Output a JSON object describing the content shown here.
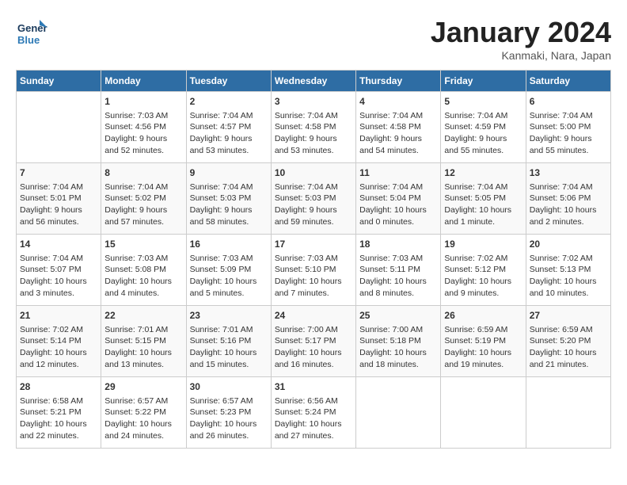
{
  "header": {
    "logo_general": "General",
    "logo_blue": "Blue",
    "month": "January 2024",
    "location": "Kanmaki, Nara, Japan"
  },
  "days_of_week": [
    "Sunday",
    "Monday",
    "Tuesday",
    "Wednesday",
    "Thursday",
    "Friday",
    "Saturday"
  ],
  "weeks": [
    [
      {
        "day": "",
        "content": ""
      },
      {
        "day": "1",
        "content": "Sunrise: 7:03 AM\nSunset: 4:56 PM\nDaylight: 9 hours\nand 52 minutes."
      },
      {
        "day": "2",
        "content": "Sunrise: 7:04 AM\nSunset: 4:57 PM\nDaylight: 9 hours\nand 53 minutes."
      },
      {
        "day": "3",
        "content": "Sunrise: 7:04 AM\nSunset: 4:58 PM\nDaylight: 9 hours\nand 53 minutes."
      },
      {
        "day": "4",
        "content": "Sunrise: 7:04 AM\nSunset: 4:58 PM\nDaylight: 9 hours\nand 54 minutes."
      },
      {
        "day": "5",
        "content": "Sunrise: 7:04 AM\nSunset: 4:59 PM\nDaylight: 9 hours\nand 55 minutes."
      },
      {
        "day": "6",
        "content": "Sunrise: 7:04 AM\nSunset: 5:00 PM\nDaylight: 9 hours\nand 55 minutes."
      }
    ],
    [
      {
        "day": "7",
        "content": "Sunrise: 7:04 AM\nSunset: 5:01 PM\nDaylight: 9 hours\nand 56 minutes."
      },
      {
        "day": "8",
        "content": "Sunrise: 7:04 AM\nSunset: 5:02 PM\nDaylight: 9 hours\nand 57 minutes."
      },
      {
        "day": "9",
        "content": "Sunrise: 7:04 AM\nSunset: 5:03 PM\nDaylight: 9 hours\nand 58 minutes."
      },
      {
        "day": "10",
        "content": "Sunrise: 7:04 AM\nSunset: 5:03 PM\nDaylight: 9 hours\nand 59 minutes."
      },
      {
        "day": "11",
        "content": "Sunrise: 7:04 AM\nSunset: 5:04 PM\nDaylight: 10 hours\nand 0 minutes."
      },
      {
        "day": "12",
        "content": "Sunrise: 7:04 AM\nSunset: 5:05 PM\nDaylight: 10 hours\nand 1 minute."
      },
      {
        "day": "13",
        "content": "Sunrise: 7:04 AM\nSunset: 5:06 PM\nDaylight: 10 hours\nand 2 minutes."
      }
    ],
    [
      {
        "day": "14",
        "content": "Sunrise: 7:04 AM\nSunset: 5:07 PM\nDaylight: 10 hours\nand 3 minutes."
      },
      {
        "day": "15",
        "content": "Sunrise: 7:03 AM\nSunset: 5:08 PM\nDaylight: 10 hours\nand 4 minutes."
      },
      {
        "day": "16",
        "content": "Sunrise: 7:03 AM\nSunset: 5:09 PM\nDaylight: 10 hours\nand 5 minutes."
      },
      {
        "day": "17",
        "content": "Sunrise: 7:03 AM\nSunset: 5:10 PM\nDaylight: 10 hours\nand 7 minutes."
      },
      {
        "day": "18",
        "content": "Sunrise: 7:03 AM\nSunset: 5:11 PM\nDaylight: 10 hours\nand 8 minutes."
      },
      {
        "day": "19",
        "content": "Sunrise: 7:02 AM\nSunset: 5:12 PM\nDaylight: 10 hours\nand 9 minutes."
      },
      {
        "day": "20",
        "content": "Sunrise: 7:02 AM\nSunset: 5:13 PM\nDaylight: 10 hours\nand 10 minutes."
      }
    ],
    [
      {
        "day": "21",
        "content": "Sunrise: 7:02 AM\nSunset: 5:14 PM\nDaylight: 10 hours\nand 12 minutes."
      },
      {
        "day": "22",
        "content": "Sunrise: 7:01 AM\nSunset: 5:15 PM\nDaylight: 10 hours\nand 13 minutes."
      },
      {
        "day": "23",
        "content": "Sunrise: 7:01 AM\nSunset: 5:16 PM\nDaylight: 10 hours\nand 15 minutes."
      },
      {
        "day": "24",
        "content": "Sunrise: 7:00 AM\nSunset: 5:17 PM\nDaylight: 10 hours\nand 16 minutes."
      },
      {
        "day": "25",
        "content": "Sunrise: 7:00 AM\nSunset: 5:18 PM\nDaylight: 10 hours\nand 18 minutes."
      },
      {
        "day": "26",
        "content": "Sunrise: 6:59 AM\nSunset: 5:19 PM\nDaylight: 10 hours\nand 19 minutes."
      },
      {
        "day": "27",
        "content": "Sunrise: 6:59 AM\nSunset: 5:20 PM\nDaylight: 10 hours\nand 21 minutes."
      }
    ],
    [
      {
        "day": "28",
        "content": "Sunrise: 6:58 AM\nSunset: 5:21 PM\nDaylight: 10 hours\nand 22 minutes."
      },
      {
        "day": "29",
        "content": "Sunrise: 6:57 AM\nSunset: 5:22 PM\nDaylight: 10 hours\nand 24 minutes."
      },
      {
        "day": "30",
        "content": "Sunrise: 6:57 AM\nSunset: 5:23 PM\nDaylight: 10 hours\nand 26 minutes."
      },
      {
        "day": "31",
        "content": "Sunrise: 6:56 AM\nSunset: 5:24 PM\nDaylight: 10 hours\nand 27 minutes."
      },
      {
        "day": "",
        "content": ""
      },
      {
        "day": "",
        "content": ""
      },
      {
        "day": "",
        "content": ""
      }
    ]
  ]
}
